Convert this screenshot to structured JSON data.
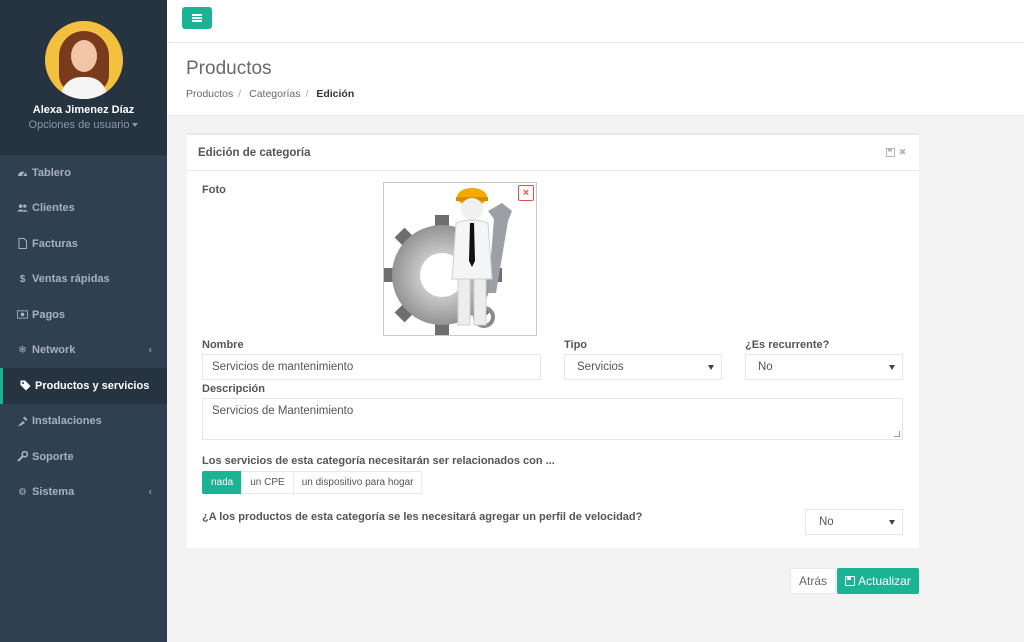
{
  "user": {
    "name": "Alexa Jimenez Díaz",
    "options_label": "Opciones de usuario"
  },
  "nav": [
    {
      "label": "Tablero",
      "icon": "dashboard-icon"
    },
    {
      "label": "Clientes",
      "icon": "users-icon"
    },
    {
      "label": "Facturas",
      "icon": "file-icon"
    },
    {
      "label": "Ventas rápidas",
      "icon": "dollar-icon"
    },
    {
      "label": "Pagos",
      "icon": "money-icon"
    },
    {
      "label": "Network",
      "icon": "network-icon",
      "has_submenu": true
    },
    {
      "label": "Productos y servicios",
      "icon": "tags-icon",
      "active": true
    },
    {
      "label": "Instalaciones",
      "icon": "install-icon"
    },
    {
      "label": "Soporte",
      "icon": "wrench-icon"
    },
    {
      "label": "Sistema",
      "icon": "cogs-icon",
      "has_submenu": true
    }
  ],
  "page": {
    "title": "Productos",
    "breadcrumb": [
      "Productos",
      "Categorías",
      "Edición"
    ]
  },
  "panel": {
    "title": "Edición de categoría"
  },
  "form": {
    "photo_label": "Foto",
    "name_label": "Nombre",
    "name_value": "Servicios de mantenimiento",
    "type_label": "Tipo",
    "type_value": "Servicios",
    "recurrent_label": "¿Es recurrente?",
    "recurrent_value": "No",
    "description_label": "Descripción",
    "description_value": "Servicios de Mantenimiento",
    "relation_label": "Los servicios de esta categoría necesitarán ser relacionados con ...",
    "relation_options": [
      "nada",
      "un CPE",
      "un dispositivo para hogar"
    ],
    "relation_selected": "nada",
    "speed_label": "¿A los productos de esta categoría se les necesitará agregar un perfil de velocidad?",
    "speed_value": "No"
  },
  "actions": {
    "back_label": "Atrás",
    "save_label": "Actualizar"
  },
  "colors": {
    "accent": "#1ab394",
    "sidebar": "#2f4050",
    "danger": "#d9534f"
  }
}
